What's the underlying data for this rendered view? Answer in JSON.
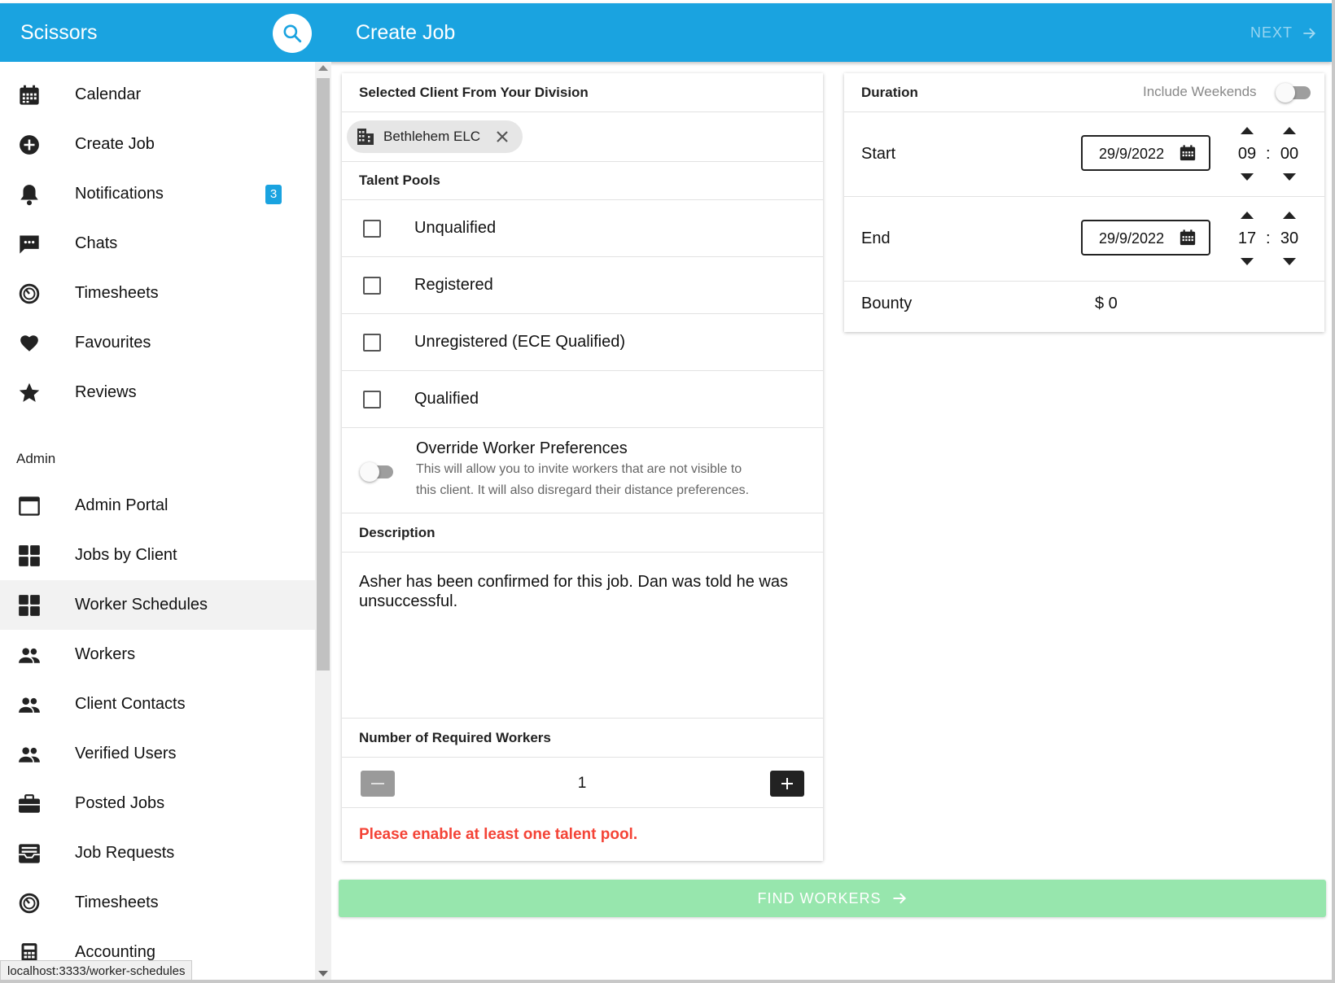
{
  "app": {
    "brand": "Scissors",
    "page_title": "Create Job",
    "next_label": "NEXT"
  },
  "sidebar": {
    "items": [
      {
        "label": "Calendar",
        "icon": "calendar-icon"
      },
      {
        "label": "Create Job",
        "icon": "add-circle-icon"
      },
      {
        "label": "Notifications",
        "icon": "bell-icon",
        "badge": "3"
      },
      {
        "label": "Chats",
        "icon": "chat-icon"
      },
      {
        "label": "Timesheets",
        "icon": "timer-icon"
      },
      {
        "label": "Favourites",
        "icon": "heart-icon"
      },
      {
        "label": "Reviews",
        "icon": "star-icon"
      }
    ],
    "admin_section": "Admin",
    "admin_items": [
      {
        "label": "Admin Portal",
        "icon": "window-icon"
      },
      {
        "label": "Jobs by Client",
        "icon": "grid-icon"
      },
      {
        "label": "Worker Schedules",
        "icon": "grid-icon"
      },
      {
        "label": "Workers",
        "icon": "people-icon"
      },
      {
        "label": "Client Contacts",
        "icon": "people-icon"
      },
      {
        "label": "Verified Users",
        "icon": "people-icon"
      },
      {
        "label": "Posted Jobs",
        "icon": "briefcase-icon"
      },
      {
        "label": "Job Requests",
        "icon": "inbox-icon"
      },
      {
        "label": "Timesheets",
        "icon": "timer-icon"
      },
      {
        "label": "Accounting",
        "icon": "calculator-icon"
      }
    ],
    "active": "Worker Schedules",
    "status_url": "localhost:3333/worker-schedules"
  },
  "form": {
    "client_header": "Selected Client From Your Division",
    "client_chip": "Bethlehem ELC",
    "talent_header": "Talent Pools",
    "talent_pools": [
      {
        "label": "Unqualified",
        "checked": false
      },
      {
        "label": "Registered",
        "checked": false
      },
      {
        "label": "Unregistered (ECE Qualified)",
        "checked": false
      },
      {
        "label": "Qualified",
        "checked": false
      }
    ],
    "override_title": "Override Worker Preferences",
    "override_desc_1": "This will allow you to invite workers that are not visible to",
    "override_desc_2": "this client. It will also disregard their distance preferences.",
    "description_header": "Description",
    "description_text": "Asher has been confirmed for this job. Dan was told he was unsuccessful.",
    "workers_header": "Number of Required Workers",
    "workers_count": "1",
    "error": "Please enable at least one talent pool.",
    "find_label": "FIND WORKERS"
  },
  "duration": {
    "header": "Duration",
    "include_weekends": "Include Weekends",
    "start_label": "Start",
    "start_date": "29/9/2022",
    "start_hour": "09",
    "start_min": "00",
    "end_label": "End",
    "end_date": "29/9/2022",
    "end_hour": "17",
    "end_min": "30",
    "bounty_label": "Bounty",
    "bounty_value": "$ 0"
  },
  "colors": {
    "primary": "#1aa3e0",
    "error": "#f44336",
    "find_button": "#97e6ad"
  }
}
